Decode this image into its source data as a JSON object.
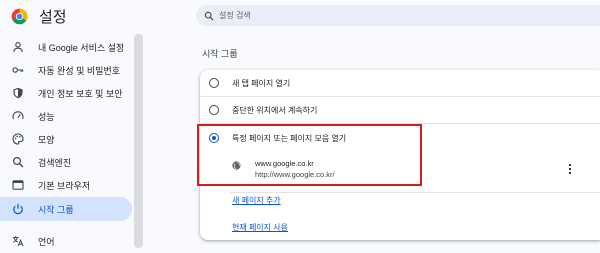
{
  "app": {
    "title": "설정"
  },
  "sidebar": {
    "items": [
      {
        "label": "내 Google 서비스 설정",
        "icon": "person-icon"
      },
      {
        "label": "자동 완성 및 비밀번호",
        "icon": "key-icon"
      },
      {
        "label": "개인 정보 보호 및 보안",
        "icon": "shield-icon"
      },
      {
        "label": "성능",
        "icon": "speedometer-icon"
      },
      {
        "label": "모양",
        "icon": "palette-icon"
      },
      {
        "label": "검색엔진",
        "icon": "search-icon"
      },
      {
        "label": "기본 브라우저",
        "icon": "browser-window-icon"
      },
      {
        "label": "시작 그룹",
        "icon": "power-icon",
        "active": true
      },
      {
        "label": "언어",
        "icon": "translate-icon"
      }
    ]
  },
  "search": {
    "placeholder": "설정 검색",
    "value": ""
  },
  "startup": {
    "section_title": "시작 그룹",
    "options": [
      {
        "label": "새 탭 페이지 열기",
        "checked": false
      },
      {
        "label": "중단한 위치에서 계속하기",
        "checked": false
      },
      {
        "label": "특정 페이지 또는 페이지 모음 열기",
        "checked": true
      }
    ],
    "pages": [
      {
        "name": "www.google.co.kr",
        "url": "http://www.google.co.kr/"
      }
    ],
    "add_page_link": "새 페이지 추가",
    "use_current_link": "현재 페이지 사용"
  },
  "colors": {
    "accent": "#0b57d0",
    "active_bg": "#d3e3fd",
    "highlight_border": "#d01f1f"
  }
}
